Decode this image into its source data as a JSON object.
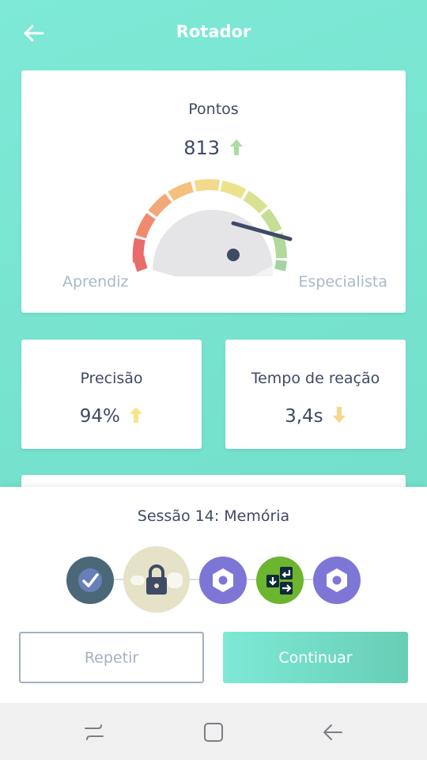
{
  "header": {
    "title": "Rotador",
    "back_icon": "arrow-left-icon"
  },
  "score": {
    "label": "Pontos",
    "value": "813",
    "trend": "up",
    "trend_color": "#a8dca0",
    "gauge_min_label": "Aprendiz",
    "gauge_max_label": "Especialista",
    "gauge_level": 0.83
  },
  "stats": [
    {
      "label": "Precisão",
      "value": "94%",
      "trend": "up",
      "trend_color": "#f7e48a"
    },
    {
      "label": "Tempo de reação",
      "value": "3,4s",
      "trend": "down",
      "trend_color": "#f7d68a"
    }
  ],
  "session": {
    "title": "Sessão 14: Memória",
    "games": [
      {
        "name": "completed-check-icon",
        "state": "completed"
      },
      {
        "name": "locked-game-icon",
        "state": "locked",
        "selected": true
      },
      {
        "name": "hexagon-game-icon",
        "state": "available"
      },
      {
        "name": "arrows-game-icon",
        "state": "available"
      },
      {
        "name": "hexagon-game-icon",
        "state": "available"
      }
    ]
  },
  "actions": {
    "repeat_label": "Repetir",
    "continue_label": "Continuar"
  },
  "colors": {
    "background": "#76e3cf",
    "accent": "#7de9d6",
    "text_dark": "#3f4a66",
    "text_muted": "#aab8c8"
  },
  "system_nav": {
    "recent_icon": "recent-apps-icon",
    "home_icon": "home-icon",
    "back_icon": "back-icon"
  }
}
